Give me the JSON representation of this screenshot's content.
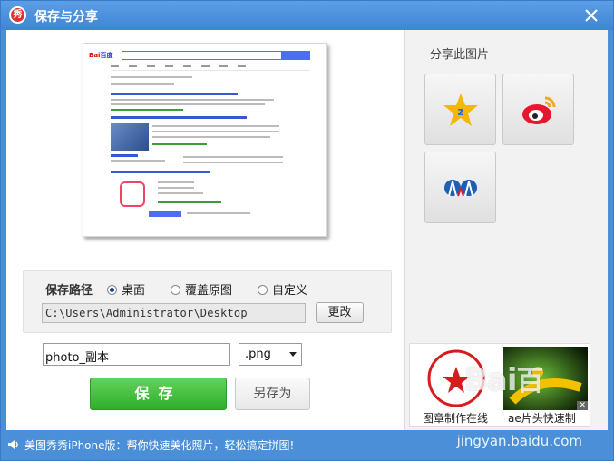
{
  "window": {
    "title": "保存与分享",
    "logo_text": "秀"
  },
  "save_path": {
    "label": "保存路径",
    "options": [
      {
        "label": "桌面",
        "selected": true
      },
      {
        "label": "覆盖原图",
        "selected": false
      },
      {
        "label": "自定义",
        "selected": false
      }
    ],
    "path_value": "C:\\Users\\Administrator\\Desktop",
    "change_button": "更改"
  },
  "file": {
    "name": "photo_副本",
    "format": ".png"
  },
  "actions": {
    "save_button": "保存",
    "save_as_button": "另存为"
  },
  "share": {
    "title": "分享此图片",
    "buttons": [
      {
        "icon": "qzone-icon"
      },
      {
        "icon": "weibo-icon"
      },
      {
        "icon": "renren-icon"
      }
    ]
  },
  "thumbnails": [
    {
      "label": "图章制作在线"
    },
    {
      "label": "ae片头快速制"
    }
  ],
  "status": {
    "text": "美图秀秀iPhone版：帮你快速美化照片，轻松搞定拼图!",
    "watermark": "jingyan.baidu.com",
    "logo_watermark": "Bai百"
  },
  "colors": {
    "title_bar": "#4a8fd8",
    "save_green": "#2fae2a",
    "accent_blue": "#3f85d3"
  }
}
